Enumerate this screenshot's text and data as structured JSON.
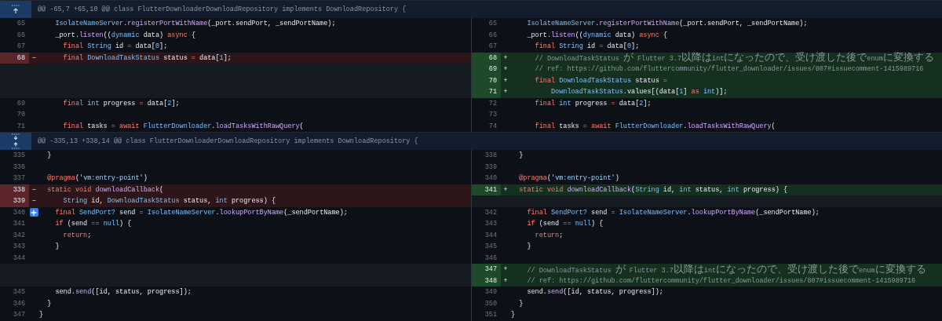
{
  "hunks": [
    {
      "kind": "up",
      "header": "@@ -65,7 +65,10 @@ class FlutterDownloaderDownloadRepository implements DownloadRepository {",
      "rows": [
        {
          "left": {
            "kind": "context",
            "num": "65",
            "code": [
              {
                "kind": "type",
                "text": "    IsolateNameServer"
              },
              {
                "kind": "plain",
                "text": "."
              },
              {
                "kind": "function",
                "text": "registerPortWithName"
              },
              {
                "kind": "plain",
                "text": "(_port.sendPort, _sendPortName);"
              }
            ]
          },
          "right": {
            "kind": "context",
            "num": "65",
            "code": [
              {
                "kind": "type",
                "text": "    IsolateNameServer"
              },
              {
                "kind": "plain",
                "text": "."
              },
              {
                "kind": "function",
                "text": "registerPortWithName"
              },
              {
                "kind": "plain",
                "text": "(_port.sendPort, _sendPortName);"
              }
            ]
          }
        },
        {
          "left": {
            "kind": "context",
            "num": "66",
            "code": [
              {
                "kind": "plain",
                "text": "    _port."
              },
              {
                "kind": "function",
                "text": "listen"
              },
              {
                "kind": "plain",
                "text": "(("
              },
              {
                "kind": "type",
                "text": "dynamic"
              },
              {
                "kind": "plain",
                "text": " data) "
              },
              {
                "kind": "keyword",
                "text": "async"
              },
              {
                "kind": "plain",
                "text": " {"
              }
            ]
          },
          "right": {
            "kind": "context",
            "num": "66",
            "code": [
              {
                "kind": "plain",
                "text": "    _port."
              },
              {
                "kind": "function",
                "text": "listen"
              },
              {
                "kind": "plain",
                "text": "(("
              },
              {
                "kind": "type",
                "text": "dynamic"
              },
              {
                "kind": "plain",
                "text": " data) "
              },
              {
                "kind": "keyword",
                "text": "async"
              },
              {
                "kind": "plain",
                "text": " {"
              }
            ]
          }
        },
        {
          "left": {
            "kind": "context",
            "num": "67",
            "code": [
              {
                "kind": "keyword",
                "text": "      final "
              },
              {
                "kind": "type",
                "text": "String"
              },
              {
                "kind": "plain",
                "text": " id "
              },
              {
                "kind": "keyword",
                "text": "="
              },
              {
                "kind": "plain",
                "text": " data["
              },
              {
                "kind": "number",
                "text": "0"
              },
              {
                "kind": "plain",
                "text": "];"
              }
            ]
          },
          "right": {
            "kind": "context",
            "num": "67",
            "code": [
              {
                "kind": "keyword",
                "text": "      final "
              },
              {
                "kind": "type",
                "text": "String"
              },
              {
                "kind": "plain",
                "text": " id "
              },
              {
                "kind": "keyword",
                "text": "="
              },
              {
                "kind": "plain",
                "text": " data["
              },
              {
                "kind": "number",
                "text": "0"
              },
              {
                "kind": "plain",
                "text": "];"
              }
            ]
          }
        },
        {
          "left": {
            "kind": "deletion",
            "num": "68",
            "sign": "−",
            "code": [
              {
                "kind": "keyword",
                "text": "      final "
              },
              {
                "kind": "type",
                "text": "DownloadTaskStatus"
              },
              {
                "kind": "plain",
                "text": " status "
              },
              {
                "kind": "keyword",
                "text": "="
              },
              {
                "kind": "plain",
                "text": " data["
              },
              {
                "kind": "number",
                "text": "1"
              },
              {
                "kind": "plain",
                "text": "];"
              }
            ]
          },
          "right": {
            "kind": "addition",
            "num": "68",
            "sign": "+",
            "code": [
              {
                "kind": "comment",
                "text": "      // DownloadTaskStatus が Flutter 3.7以降はintになったので、受け渡した後でenumに変換する"
              }
            ]
          }
        },
        {
          "left": {
            "kind": "empty"
          },
          "right": {
            "kind": "addition",
            "num": "69",
            "sign": "+",
            "code": [
              {
                "kind": "comment",
                "text": "      // ref: https://github.com/fluttercommunity/flutter_downloader/issues/807#issuecomment-1415989716"
              }
            ]
          }
        },
        {
          "left": {
            "kind": "empty"
          },
          "right": {
            "kind": "addition",
            "num": "70",
            "sign": "+",
            "code": [
              {
                "kind": "keyword",
                "text": "      final "
              },
              {
                "kind": "type",
                "text": "DownloadTaskStatus"
              },
              {
                "kind": "plain",
                "text": " status "
              },
              {
                "kind": "keyword",
                "text": "="
              }
            ]
          }
        },
        {
          "left": {
            "kind": "empty"
          },
          "right": {
            "kind": "addition",
            "num": "71",
            "sign": "+",
            "code": [
              {
                "kind": "type",
                "text": "          DownloadTaskStatus"
              },
              {
                "kind": "plain",
                "text": ".values[(data["
              },
              {
                "kind": "number",
                "text": "1"
              },
              {
                "kind": "plain",
                "text": "] "
              },
              {
                "kind": "keyword",
                "text": "as "
              },
              {
                "kind": "type",
                "text": "int"
              },
              {
                "kind": "plain",
                "text": ")];"
              }
            ]
          }
        },
        {
          "left": {
            "kind": "context",
            "num": "69",
            "code": [
              {
                "kind": "keyword",
                "text": "      final "
              },
              {
                "kind": "type",
                "text": "int"
              },
              {
                "kind": "plain",
                "text": " progress "
              },
              {
                "kind": "keyword",
                "text": "="
              },
              {
                "kind": "plain",
                "text": " data["
              },
              {
                "kind": "number",
                "text": "2"
              },
              {
                "kind": "plain",
                "text": "];"
              }
            ]
          },
          "right": {
            "kind": "context",
            "num": "72",
            "code": [
              {
                "kind": "keyword",
                "text": "      final "
              },
              {
                "kind": "type",
                "text": "int"
              },
              {
                "kind": "plain",
                "text": " progress "
              },
              {
                "kind": "keyword",
                "text": "="
              },
              {
                "kind": "plain",
                "text": " data["
              },
              {
                "kind": "number",
                "text": "2"
              },
              {
                "kind": "plain",
                "text": "];"
              }
            ]
          }
        },
        {
          "left": {
            "kind": "context",
            "num": "70"
          },
          "right": {
            "kind": "context",
            "num": "73"
          }
        },
        {
          "left": {
            "kind": "context",
            "num": "71",
            "code": [
              {
                "kind": "keyword",
                "text": "      final "
              },
              {
                "kind": "plain",
                "text": "tasks "
              },
              {
                "kind": "keyword",
                "text": "= await "
              },
              {
                "kind": "type",
                "text": "FlutterDownloader"
              },
              {
                "kind": "plain",
                "text": "."
              },
              {
                "kind": "function",
                "text": "loadTasksWithRawQuery"
              },
              {
                "kind": "plain",
                "text": "("
              }
            ]
          },
          "right": {
            "kind": "context",
            "num": "74",
            "code": [
              {
                "kind": "keyword",
                "text": "      final "
              },
              {
                "kind": "plain",
                "text": "tasks "
              },
              {
                "kind": "keyword",
                "text": "= await "
              },
              {
                "kind": "type",
                "text": "FlutterDownloader"
              },
              {
                "kind": "plain",
                "text": "."
              },
              {
                "kind": "function",
                "text": "loadTasksWithRawQuery"
              },
              {
                "kind": "plain",
                "text": "("
              }
            ]
          }
        }
      ]
    },
    {
      "kind": "both",
      "header": "@@ -335,13 +338,14 @@ class FlutterDownloaderDownloadRepository implements DownloadRepository {",
      "rows": [
        {
          "left": {
            "kind": "context",
            "num": "335",
            "code": [
              {
                "kind": "plain",
                "text": "  }"
              }
            ]
          },
          "right": {
            "kind": "context",
            "num": "338",
            "code": [
              {
                "kind": "plain",
                "text": "  }"
              }
            ]
          }
        },
        {
          "left": {
            "kind": "context",
            "num": "336"
          },
          "right": {
            "kind": "context",
            "num": "339"
          }
        },
        {
          "left": {
            "kind": "context",
            "num": "337",
            "code": [
              {
                "kind": "keyword",
                "text": "  @pragma"
              },
              {
                "kind": "plain",
                "text": "("
              },
              {
                "kind": "string",
                "text": "'vm:entry-point'"
              },
              {
                "kind": "plain",
                "text": ")"
              }
            ]
          },
          "right": {
            "kind": "context",
            "num": "340",
            "code": [
              {
                "kind": "keyword",
                "text": "  @pragma"
              },
              {
                "kind": "plain",
                "text": "("
              },
              {
                "kind": "string",
                "text": "'vm:entry-point'"
              },
              {
                "kind": "plain",
                "text": ")"
              }
            ]
          }
        },
        {
          "left": {
            "kind": "deletion",
            "num": "338",
            "sign": "−",
            "code": [
              {
                "kind": "keyword",
                "text": "  static void "
              },
              {
                "kind": "function",
                "text": "downloadCallback"
              },
              {
                "kind": "plain",
                "text": "("
              }
            ]
          },
          "right": {
            "kind": "addition",
            "num": "341",
            "sign": "+",
            "code": [
              {
                "kind": "keyword",
                "text": "  static void "
              },
              {
                "kind": "function",
                "text": "downloadCallback"
              },
              {
                "kind": "plain",
                "text": "("
              },
              {
                "kind": "type",
                "text": "String"
              },
              {
                "kind": "plain",
                "text": " id, "
              },
              {
                "kind": "type",
                "text": "int"
              },
              {
                "kind": "plain",
                "text": " status, "
              },
              {
                "kind": "type",
                "text": "int"
              },
              {
                "kind": "plain",
                "text": " progress) {"
              }
            ]
          }
        },
        {
          "left": {
            "kind": "deletion",
            "num": "339",
            "sign": "−",
            "code": [
              {
                "kind": "type",
                "text": "      String"
              },
              {
                "kind": "plain",
                "text": " id, "
              },
              {
                "kind": "type",
                "text": "DownloadTaskStatus"
              },
              {
                "kind": "plain",
                "text": " status, "
              },
              {
                "kind": "type",
                "text": "int"
              },
              {
                "kind": "plain",
                "text": " progress) {"
              }
            ]
          },
          "right": {
            "kind": "empty"
          }
        },
        {
          "left": {
            "kind": "context",
            "num": "340",
            "comment_button": true,
            "code": [
              {
                "kind": "keyword",
                "text": "    final "
              },
              {
                "kind": "type",
                "text": "SendPort?"
              },
              {
                "kind": "plain",
                "text": " send "
              },
              {
                "kind": "keyword",
                "text": "="
              },
              {
                "kind": "type",
                "text": " IsolateNameServer"
              },
              {
                "kind": "plain",
                "text": "."
              },
              {
                "kind": "function",
                "text": "lookupPortByName"
              },
              {
                "kind": "plain",
                "text": "(_sendPortName);"
              }
            ]
          },
          "right": {
            "kind": "context",
            "num": "342",
            "code": [
              {
                "kind": "keyword",
                "text": "    final "
              },
              {
                "kind": "type",
                "text": "SendPort?"
              },
              {
                "kind": "plain",
                "text": " send "
              },
              {
                "kind": "keyword",
                "text": "="
              },
              {
                "kind": "type",
                "text": " IsolateNameServer"
              },
              {
                "kind": "plain",
                "text": "."
              },
              {
                "kind": "function",
                "text": "lookupPortByName"
              },
              {
                "kind": "plain",
                "text": "(_sendPortName);"
              }
            ]
          }
        },
        {
          "left": {
            "kind": "context",
            "num": "341",
            "code": [
              {
                "kind": "keyword",
                "text": "    if"
              },
              {
                "kind": "plain",
                "text": " (send "
              },
              {
                "kind": "keyword",
                "text": "=="
              },
              {
                "kind": "type",
                "text": " null"
              },
              {
                "kind": "plain",
                "text": ") {"
              }
            ]
          },
          "right": {
            "kind": "context",
            "num": "343",
            "code": [
              {
                "kind": "keyword",
                "text": "    if"
              },
              {
                "kind": "plain",
                "text": " (send "
              },
              {
                "kind": "keyword",
                "text": "=="
              },
              {
                "kind": "type",
                "text": " null"
              },
              {
                "kind": "plain",
                "text": ") {"
              }
            ]
          }
        },
        {
          "left": {
            "kind": "context",
            "num": "342",
            "code": [
              {
                "kind": "keyword",
                "text": "      return"
              },
              {
                "kind": "plain",
                "text": ";"
              }
            ]
          },
          "right": {
            "kind": "context",
            "num": "344",
            "code": [
              {
                "kind": "keyword",
                "text": "      return"
              },
              {
                "kind": "plain",
                "text": ";"
              }
            ]
          }
        },
        {
          "left": {
            "kind": "context",
            "num": "343",
            "code": [
              {
                "kind": "plain",
                "text": "    }"
              }
            ]
          },
          "right": {
            "kind": "context",
            "num": "345",
            "code": [
              {
                "kind": "plain",
                "text": "    }"
              }
            ]
          }
        },
        {
          "left": {
            "kind": "context",
            "num": "344"
          },
          "right": {
            "kind": "context",
            "num": "346"
          }
        },
        {
          "left": {
            "kind": "empty"
          },
          "right": {
            "kind": "addition",
            "num": "347",
            "sign": "+",
            "code": [
              {
                "kind": "comment",
                "text": "    // DownloadTaskStatus が Flutter 3.7以降はintになったので、受け渡した後でenumに変換する"
              }
            ]
          }
        },
        {
          "left": {
            "kind": "empty"
          },
          "right": {
            "kind": "addition",
            "num": "348",
            "sign": "+",
            "code": [
              {
                "kind": "comment",
                "text": "    // ref: https://github.com/fluttercommunity/flutter_downloader/issues/807#issuecomment-1415989716"
              }
            ]
          }
        },
        {
          "left": {
            "kind": "context",
            "num": "345",
            "code": [
              {
                "kind": "plain",
                "text": "    send."
              },
              {
                "kind": "function",
                "text": "send"
              },
              {
                "kind": "plain",
                "text": "([id, status, progress]);"
              }
            ]
          },
          "right": {
            "kind": "context",
            "num": "349",
            "code": [
              {
                "kind": "plain",
                "text": "    send."
              },
              {
                "kind": "function",
                "text": "send"
              },
              {
                "kind": "plain",
                "text": "([id, status, progress]);"
              }
            ]
          }
        },
        {
          "left": {
            "kind": "context",
            "num": "346",
            "code": [
              {
                "kind": "plain",
                "text": "  }"
              }
            ]
          },
          "right": {
            "kind": "context",
            "num": "350",
            "code": [
              {
                "kind": "plain",
                "text": "  }"
              }
            ]
          }
        },
        {
          "left": {
            "kind": "context",
            "num": "347",
            "code": [
              {
                "kind": "plain",
                "text": "}"
              }
            ]
          },
          "right": {
            "kind": "context",
            "num": "351",
            "code": [
              {
                "kind": "plain",
                "text": "}"
              }
            ]
          }
        }
      ]
    }
  ]
}
